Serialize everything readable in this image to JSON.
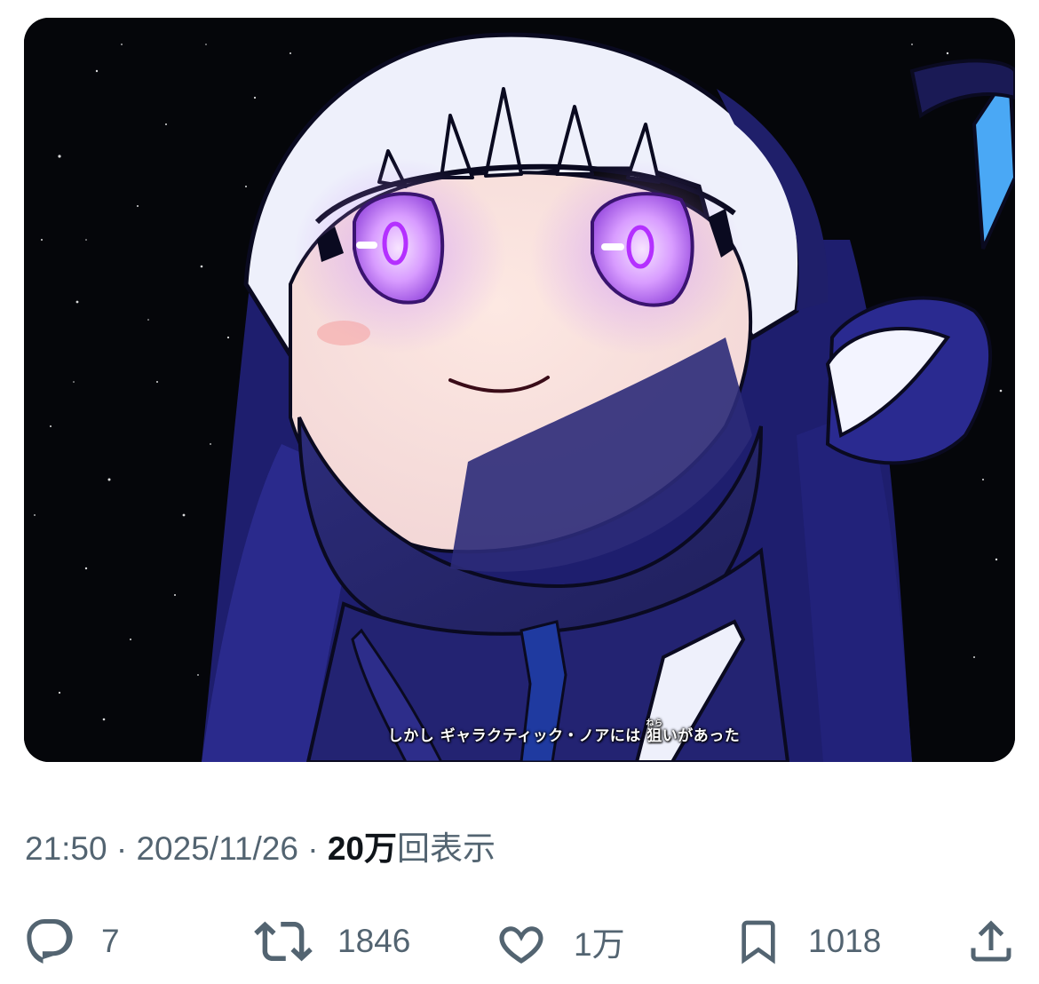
{
  "post": {
    "image": {
      "caption": "しかし ギャラクティック・ノアには 狙いがあった",
      "ruby": "ねら"
    },
    "meta": {
      "time": "21:50",
      "separator": "·",
      "date": "2025/11/26",
      "views_count": "20万",
      "views_label": "回表示"
    },
    "actions": {
      "reply": {
        "icon": "reply-bubble-icon",
        "count": "7"
      },
      "repost": {
        "icon": "repost-arrows-icon",
        "count": "1846"
      },
      "like": {
        "icon": "heart-icon",
        "count": "1万"
      },
      "bookmark": {
        "icon": "bookmark-icon",
        "count": "1018"
      },
      "share": {
        "icon": "share-upload-icon"
      }
    }
  },
  "colors": {
    "text_secondary": "#536471",
    "text_primary": "#0f1419",
    "image_bg": "#05060a",
    "character_navy": "#2b2a78",
    "eye_glow": "#c98bff"
  }
}
